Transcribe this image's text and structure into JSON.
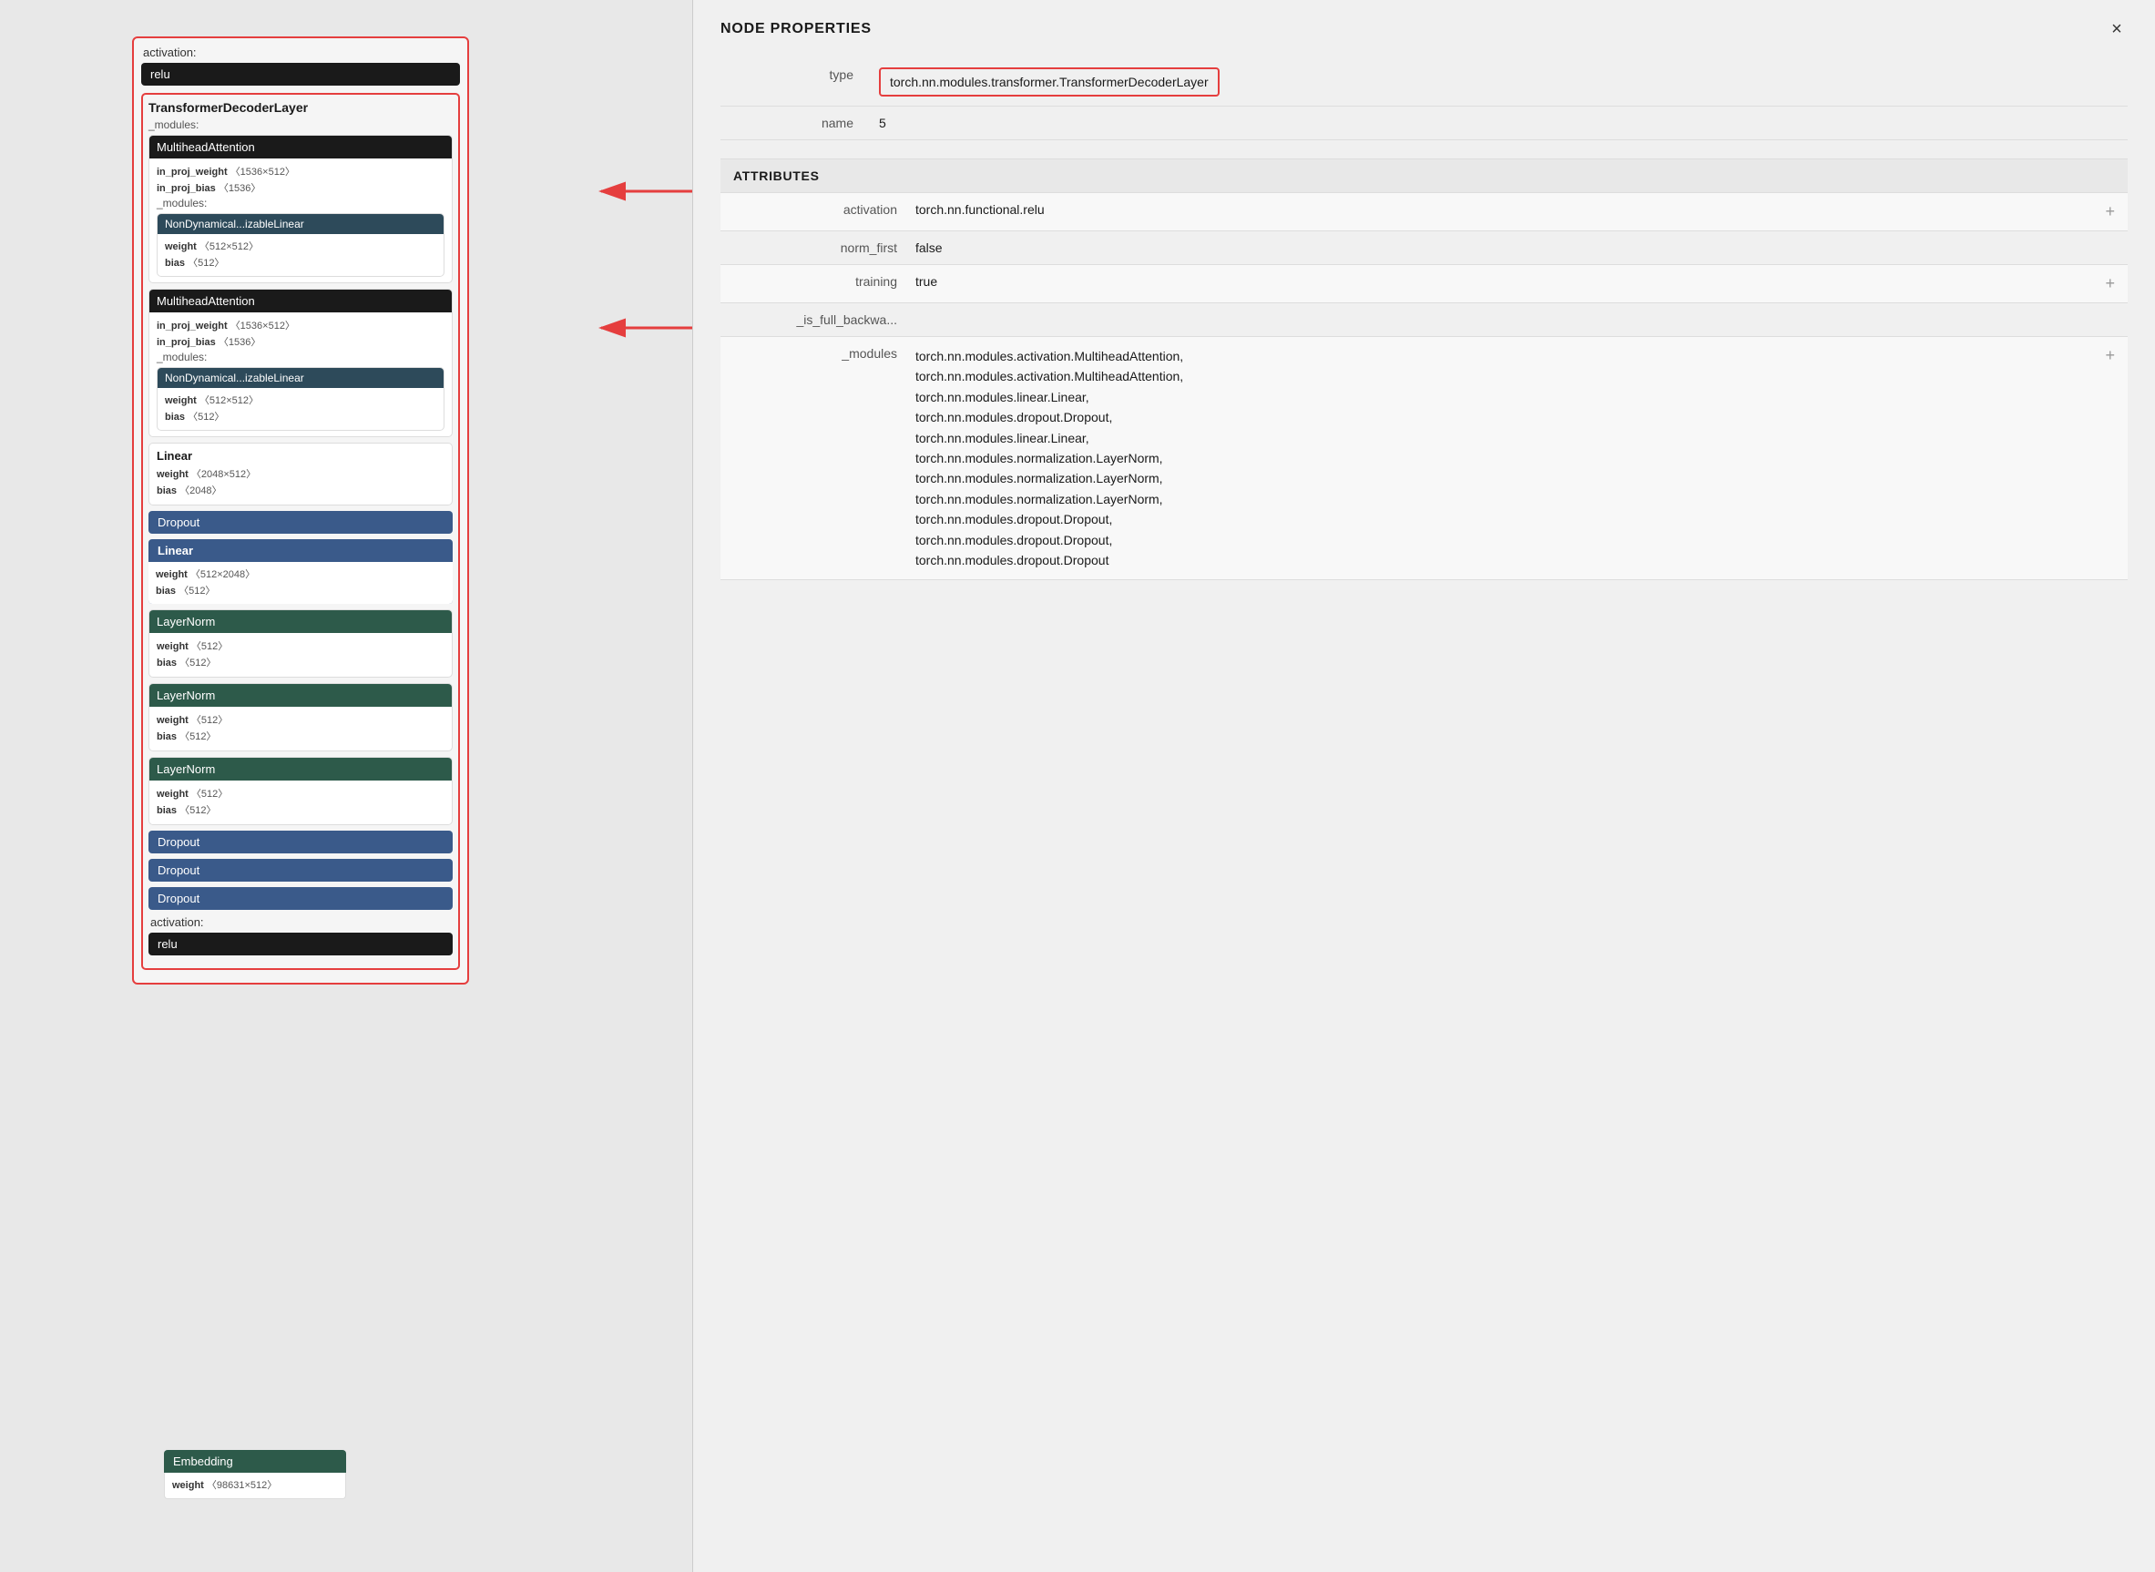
{
  "panel": {
    "title": "NODE PROPERTIES",
    "close_label": "×",
    "type_label": "type",
    "type_value": "torch.nn.modules.transformer.TransformerDecoderLayer",
    "name_label": "name",
    "name_value": "5",
    "attributes_header": "ATTRIBUTES",
    "attributes": [
      {
        "label": "activation",
        "value": "torch.nn.functional.relu",
        "has_plus": true
      },
      {
        "label": "norm_first",
        "value": "false",
        "has_plus": false
      },
      {
        "label": "training",
        "value": "true",
        "has_plus": true
      },
      {
        "label": "_is_full_backwa...",
        "value": "",
        "has_plus": false
      },
      {
        "label": "_modules",
        "value": "torch.nn.modules.activation.MultiheadAttention,\ntorch.nn.modules.activation.MultiheadAttention,\ntorch.nn.modules.linear.Linear,\ntorch.nn.modules.dropout.Dropout,\ntorch.nn.modules.linear.Linear,\ntorch.nn.modules.normalization.LayerNorm,\ntorch.nn.modules.normalization.LayerNorm,\ntorch.nn.modules.normalization.LayerNorm,\ntorch.nn.modules.dropout.Dropout,\ntorch.nn.modules.dropout.Dropout,\ntorch.nn.modules.dropout.Dropout",
        "has_plus": true
      }
    ]
  },
  "left": {
    "activation_top_label": "activation:",
    "relu_top": "relu",
    "transformer_title": "TransformerDecoderLayer",
    "modules_label": "_modules:",
    "multihead1": {
      "title": "MultiheadAttention",
      "params": [
        {
          "name": "in_proj_weight",
          "dim": "〈1536×512〉"
        },
        {
          "name": "in_proj_bias",
          "dim": "〈1536〉"
        }
      ],
      "modules_label": "_modules:",
      "nondyn_title": "NonDynamical...izableLinear",
      "nondyn_params": [
        {
          "name": "weight",
          "dim": "〈512×512〉"
        },
        {
          "name": "bias",
          "dim": "〈512〉"
        }
      ]
    },
    "multihead2": {
      "title": "MultiheadAttention",
      "params": [
        {
          "name": "in_proj_weight",
          "dim": "〈1536×512〉"
        },
        {
          "name": "in_proj_bias",
          "dim": "〈1536〉"
        }
      ],
      "modules_label": "_modules:",
      "nondyn_title": "NonDynamical...izableLinear",
      "nondyn_params": [
        {
          "name": "weight",
          "dim": "〈512×512〉"
        },
        {
          "name": "bias",
          "dim": "〈512〉"
        }
      ]
    },
    "linear1": {
      "title": "Linear",
      "params": [
        {
          "name": "weight",
          "dim": "〈2048×512〉"
        },
        {
          "name": "bias",
          "dim": "〈2048〉"
        }
      ]
    },
    "dropout1": "Dropout",
    "linear2": {
      "title": "Linear",
      "params": [
        {
          "name": "weight",
          "dim": "〈512×2048〉"
        },
        {
          "name": "bias",
          "dim": "〈512〉"
        }
      ]
    },
    "layernorm1": {
      "title": "LayerNorm",
      "params": [
        {
          "name": "weight",
          "dim": "〈512〉"
        },
        {
          "name": "bias",
          "dim": "〈512〉"
        }
      ]
    },
    "layernorm2": {
      "title": "LayerNorm",
      "params": [
        {
          "name": "weight",
          "dim": "〈512〉"
        },
        {
          "name": "bias",
          "dim": "〈512〉"
        }
      ]
    },
    "layernorm3": {
      "title": "LayerNorm",
      "params": [
        {
          "name": "weight",
          "dim": "〈512〉"
        },
        {
          "name": "bias",
          "dim": "〈512〉"
        }
      ]
    },
    "dropout2": "Dropout",
    "dropout3": "Dropout",
    "dropout4": "Dropout",
    "activation_bottom_label": "activation:",
    "relu_bottom": "relu",
    "embedding": {
      "title": "Embedding",
      "params": [
        {
          "name": "weight",
          "dim": "〈98631×512〉"
        }
      ]
    }
  }
}
